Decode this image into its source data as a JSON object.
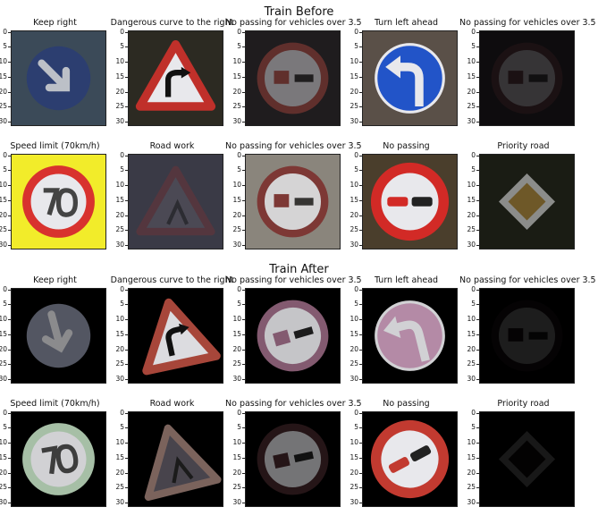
{
  "sections": [
    {
      "title": "Train Before",
      "rows": [
        [
          {
            "title": "Keep right",
            "sign": "keep-right",
            "bg": "#3b4a58",
            "tone": "#273a78",
            "rot": 0,
            "dim": 0.75
          },
          {
            "title": "Dangerous curve to the right",
            "sign": "curve-right",
            "bg": "#2c2a22",
            "tone": "#c0302a",
            "rot": 0,
            "dim": 1
          },
          {
            "title": "No passing for vehicles over 3.5",
            "sign": "no-passing-trucks",
            "bg": "#1f1c1e",
            "tone": "#b0473f",
            "rot": 0,
            "dim": 0.45
          },
          {
            "title": "Turn left ahead",
            "sign": "turn-left",
            "bg": "#5a5048",
            "tone": "#2254c8",
            "rot": 0,
            "dim": 1
          },
          {
            "title": "No passing for vehicles over 3.5",
            "sign": "no-passing-trucks",
            "bg": "#0e0c0e",
            "tone": "#5a2b2c",
            "rot": 0,
            "dim": 0.18
          }
        ],
        [
          {
            "title": "Speed limit (70km/h)",
            "sign": "speed-70",
            "bg": "#f2ec2a",
            "tone": "#d8322e",
            "rot": 0,
            "dim": 1
          },
          {
            "title": "Road work",
            "sign": "road-work",
            "bg": "#3a3a46",
            "tone": "#6a3438",
            "rot": 0,
            "dim": 0.55
          },
          {
            "title": "No passing for vehicles over 3.5",
            "sign": "no-passing-trucks",
            "bg": "#8a857c",
            "tone": "#7a2624",
            "rot": 0,
            "dim": 0.8
          },
          {
            "title": "No passing",
            "sign": "no-passing",
            "bg": "#4a3e2c",
            "tone": "#d22a26",
            "rot": 0,
            "dim": 1
          },
          {
            "title": "Priority road",
            "sign": "priority",
            "bg": "#1a1c14",
            "tone": "#b38a3a",
            "rot": 0,
            "dim": 0.55
          }
        ]
      ]
    },
    {
      "title": "Train After",
      "rows": [
        [
          {
            "title": "Keep right",
            "sign": "keep-right",
            "bg": "#000000",
            "tone": "#8a90a4",
            "rot": 30,
            "dim": 0.6
          },
          {
            "title": "Dangerous curve to the right",
            "sign": "curve-right",
            "bg": "#000000",
            "tone": "#b04a3e",
            "rot": -12,
            "dim": 0.95
          },
          {
            "title": "No passing for vehicles over 3.5",
            "sign": "no-passing-trucks",
            "bg": "#000000",
            "tone": "#9a6a84",
            "rot": -16,
            "dim": 0.85
          },
          {
            "title": "Turn left ahead",
            "sign": "turn-left",
            "bg": "#000000",
            "tone": "#c89ab8",
            "rot": -14,
            "dim": 0.9
          },
          {
            "title": "No passing for vehicles over 3.5",
            "sign": "no-passing-trucks",
            "bg": "#000000",
            "tone": "#2a1e22",
            "rot": 0,
            "dim": 0.12
          }
        ],
        [
          {
            "title": "Speed limit (70km/h)",
            "sign": "speed-70",
            "bg": "#000000",
            "tone": "#b8d4b8",
            "rot": -10,
            "dim": 0.9
          },
          {
            "title": "Road work",
            "sign": "road-work",
            "bg": "#000000",
            "tone": "#9a7c74",
            "rot": -14,
            "dim": 0.8
          },
          {
            "title": "No passing for vehicles over 3.5",
            "sign": "no-passing-trucks",
            "bg": "#000000",
            "tone": "#4a2a2e",
            "rot": -12,
            "dim": 0.5
          },
          {
            "title": "No passing",
            "sign": "no-passing",
            "bg": "#000000",
            "tone": "#c23a30",
            "rot": -28,
            "dim": 1
          },
          {
            "title": "Priority road",
            "sign": "priority",
            "bg": "#000000",
            "tone": "#221c1a",
            "rot": 0,
            "dim": 0.1
          }
        ]
      ]
    }
  ],
  "chart_data": {
    "type": "image-grid",
    "panel_axis": {
      "ylim": [
        31,
        0
      ],
      "yticks": [
        0,
        5,
        10,
        15,
        20,
        25,
        30
      ]
    },
    "panels": [
      {
        "section": "Train Before",
        "row": 0,
        "col": 0,
        "label": "Keep right"
      },
      {
        "section": "Train Before",
        "row": 0,
        "col": 1,
        "label": "Dangerous curve to the right"
      },
      {
        "section": "Train Before",
        "row": 0,
        "col": 2,
        "label": "No passing for vehicles over 3.5"
      },
      {
        "section": "Train Before",
        "row": 0,
        "col": 3,
        "label": "Turn left ahead"
      },
      {
        "section": "Train Before",
        "row": 0,
        "col": 4,
        "label": "No passing for vehicles over 3.5"
      },
      {
        "section": "Train Before",
        "row": 1,
        "col": 0,
        "label": "Speed limit (70km/h)"
      },
      {
        "section": "Train Before",
        "row": 1,
        "col": 1,
        "label": "Road work"
      },
      {
        "section": "Train Before",
        "row": 1,
        "col": 2,
        "label": "No passing for vehicles over 3.5"
      },
      {
        "section": "Train Before",
        "row": 1,
        "col": 3,
        "label": "No passing"
      },
      {
        "section": "Train Before",
        "row": 1,
        "col": 4,
        "label": "Priority road"
      },
      {
        "section": "Train After",
        "row": 0,
        "col": 0,
        "label": "Keep right"
      },
      {
        "section": "Train After",
        "row": 0,
        "col": 1,
        "label": "Dangerous curve to the right"
      },
      {
        "section": "Train After",
        "row": 0,
        "col": 2,
        "label": "No passing for vehicles over 3.5"
      },
      {
        "section": "Train After",
        "row": 0,
        "col": 3,
        "label": "Turn left ahead"
      },
      {
        "section": "Train After",
        "row": 0,
        "col": 4,
        "label": "No passing for vehicles over 3.5"
      },
      {
        "section": "Train After",
        "row": 1,
        "col": 0,
        "label": "Speed limit (70km/h)"
      },
      {
        "section": "Train After",
        "row": 1,
        "col": 1,
        "label": "Road work"
      },
      {
        "section": "Train After",
        "row": 1,
        "col": 2,
        "label": "No passing for vehicles over 3.5"
      },
      {
        "section": "Train After",
        "row": 1,
        "col": 3,
        "label": "No passing"
      },
      {
        "section": "Train After",
        "row": 1,
        "col": 4,
        "label": "Priority road"
      }
    ]
  }
}
